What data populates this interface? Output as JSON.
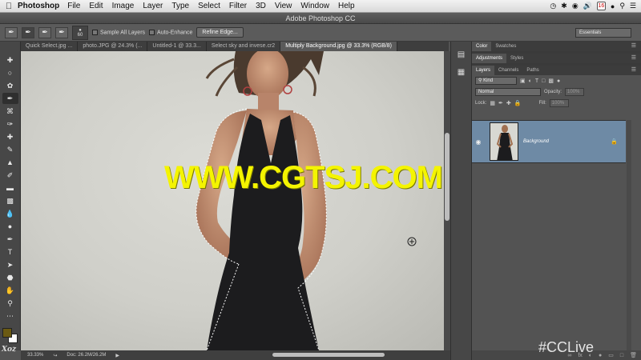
{
  "menubar": {
    "app_name": "Photoshop",
    "items": [
      "File",
      "Edit",
      "Image",
      "Layer",
      "Type",
      "Select",
      "Filter",
      "3D",
      "View",
      "Window",
      "Help"
    ],
    "calendar_day": "16"
  },
  "window": {
    "title": "Adobe Photoshop CC"
  },
  "options": {
    "brush_size": "60",
    "sample_all_layers": "Sample All Layers",
    "auto_enhance": "Auto-Enhance",
    "refine_edge": "Refine Edge...",
    "workspace": "Essentials"
  },
  "tabs": [
    "Quick Select.jpg ...",
    "photo.JPG @ 24.3% (...",
    "Untitled-1 @ 33.3...",
    "Select sky and invese.cr2",
    "Multiply Background.jpg @ 33.3% (RGB/8)"
  ],
  "status": {
    "zoom": "33.33%",
    "doc": "Doc: 26.2M/26.2M"
  },
  "panels": {
    "top_tabs": [
      "Color",
      "Swatches"
    ],
    "mid_tabs": [
      "Adjustments",
      "Styles"
    ],
    "layer_tabs": [
      "Layers",
      "Channels",
      "Paths"
    ],
    "kind": "Kind",
    "blend_mode": "Normal",
    "opacity_label": "Opacity:",
    "opacity_value": "100%",
    "lock_label": "Lock:",
    "fill_label": "Fill:",
    "fill_value": "100%",
    "layer_name": "Background"
  },
  "watermark": "WWW.CGTSJ.COM",
  "logo_text": "Xoz",
  "corner_text": "#CCLive",
  "colors": {
    "foreground": "#6b5a12",
    "background": "#ffffff",
    "selected_layer": "#6e8aa5"
  }
}
